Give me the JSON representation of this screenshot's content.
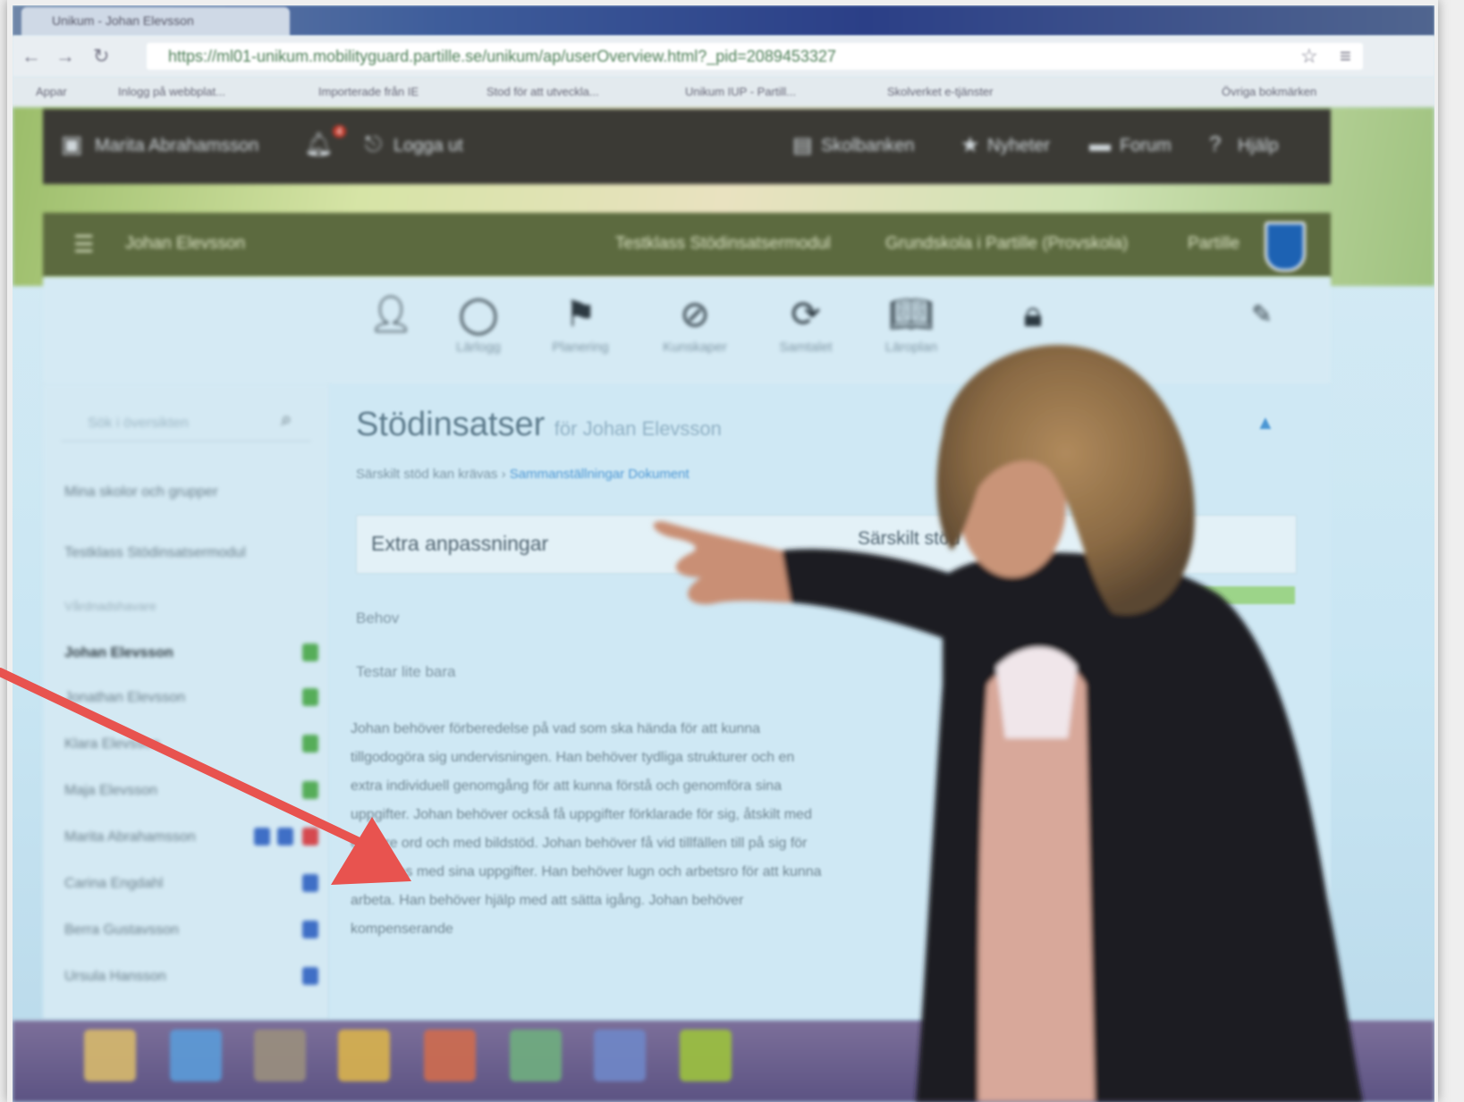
{
  "browser": {
    "tab_title": "Unikum - Johan Elevsson",
    "url": "https://ml01-unikum.mobilityguard.partille.se/unikum/ap/userOverview.html?_pid=2089453327",
    "bookmarks": [
      "Appar",
      "Inlogg på webbplat...",
      "Importerade från IE",
      "Stod för att utveckla...",
      "Unikum IUP - Partill...",
      "Skolverket e-tjänster",
      "Övriga bokmärken"
    ]
  },
  "app_header": {
    "user": "Marita Abrahamsson",
    "notification_count": "4",
    "logout": "Logga ut",
    "links": [
      "Skolbanken",
      "Nyheter",
      "Forum",
      "Hjälp"
    ]
  },
  "student_bar": {
    "student": "Johan Elevsson",
    "class": "Testklass Stödinsatsermodul",
    "school": "Grundskola i Partille (Provskola)",
    "municipality": "Partille"
  },
  "toolbar": {
    "items": [
      "Lärlogg",
      "Planering",
      "Kunskaper",
      "Samtalet",
      "Läroplan"
    ]
  },
  "sidebar": {
    "search_placeholder": "Sök i översikten",
    "items": [
      "Mina skolor och grupper",
      "Testklass Stödinsatsermodul",
      "Vårdnadshavare",
      "Johan Elevsson",
      "Jonathan Elevsson",
      "Klara Elevsson",
      "Maja Elevsson",
      "Marita Abrahamsson",
      "Carina Engdahl",
      "Berra Gustavsson",
      "Ursula Hansson"
    ]
  },
  "main": {
    "title": "Stödinsatser",
    "title_suffix": "för Johan Elevsson",
    "crumb_text": "Särskilt stöd kan krävas",
    "crumb_links": "Sammanställningar Dokument",
    "section_title": "Extra anpassningar",
    "section_right": "Särskilt stöd",
    "label_need": "Behov",
    "label_test": "Testar lite bara",
    "paragraph": "Johan behöver förberedelse på vad som ska hända för att kunna tillgodogöra sig undervisningen. Han behöver tydliga strukturer och en extra individuell genomgång för att kunna förstå och genomföra sina uppgifter. Johan behöver också få uppgifter förklarade för sig, åtskilt med enklare ord och med bildstöd. Johan behöver få vid tillfällen till på sig för att nu kas med sina uppgifter. Han behöver lugn och arbetsro för att kunna arbeta. Han behöver hjälp med att sätta igång. Johan behöver kompenserande"
  },
  "colors": {
    "arrow": "#e8534f",
    "app_header": "#3b3a35",
    "student_bar": "#5c6a3f",
    "accent_link": "#4c97d4"
  }
}
